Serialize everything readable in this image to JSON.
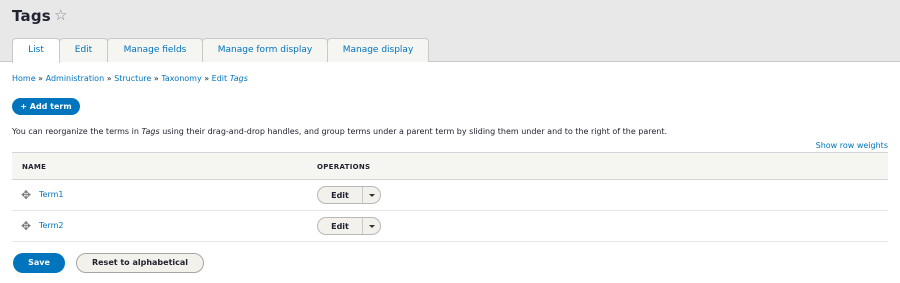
{
  "page": {
    "title": "Tags",
    "star_icon": "star-outline-icon"
  },
  "tabs": [
    {
      "label": "List",
      "active": true
    },
    {
      "label": "Edit",
      "active": false
    },
    {
      "label": "Manage fields",
      "active": false
    },
    {
      "label": "Manage form display",
      "active": false
    },
    {
      "label": "Manage display",
      "active": false
    }
  ],
  "breadcrumb": {
    "items": [
      "Home",
      "Administration",
      "Structure",
      "Taxonomy",
      "Edit"
    ],
    "current_emphasis": "Tags",
    "separator": "»"
  },
  "actions": {
    "add_term": "+ Add term"
  },
  "help": {
    "before": "You can reorganize the terms in ",
    "vocab": "Tags",
    "after": " using their drag-and-drop handles, and group terms under a parent term by sliding them under and to the right of the parent."
  },
  "show_row_weights": "Show row weights",
  "table": {
    "headers": {
      "name": "NAME",
      "operations": "OPERATIONS"
    },
    "rows": [
      {
        "name": "Term1",
        "operation": "Edit"
      },
      {
        "name": "Term2",
        "operation": "Edit"
      }
    ]
  },
  "form_actions": {
    "save": "Save",
    "reset": "Reset to alphabetical"
  },
  "colors": {
    "accent": "#0074bd",
    "header_bg": "#e8e8e8"
  }
}
